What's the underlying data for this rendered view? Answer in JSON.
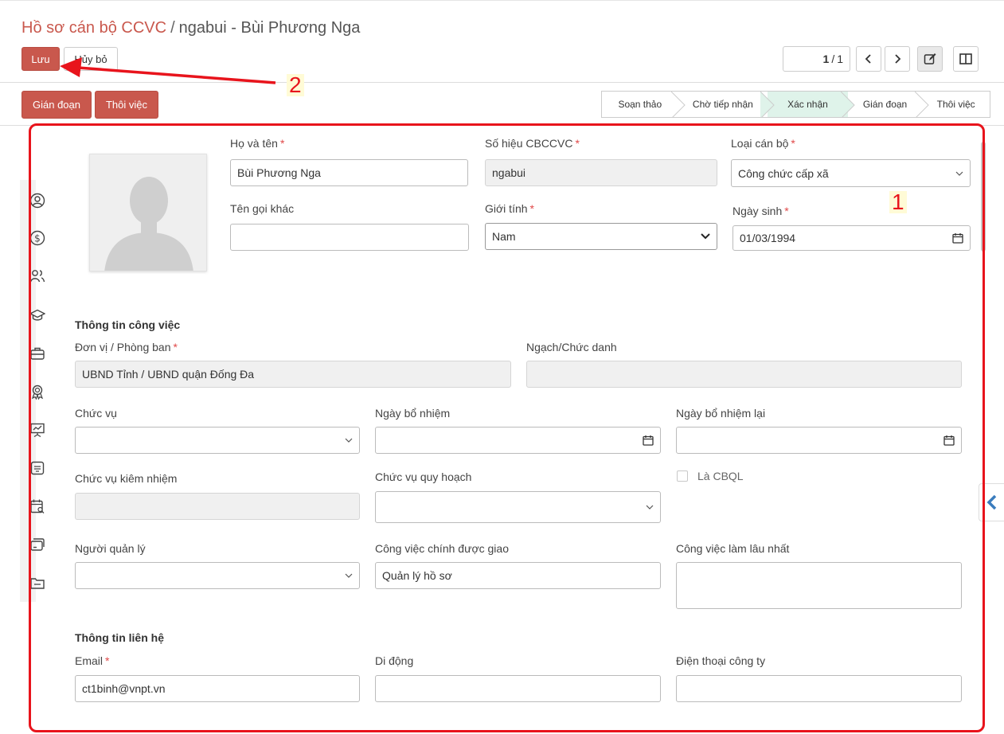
{
  "breadcrumb": {
    "parent": "Hồ sơ cán bộ CCVC",
    "separator": "/",
    "current": "ngabui - Bùi Phương Nga"
  },
  "toolbar": {
    "save_label": "Lưu",
    "discard_label": "Hủy bỏ"
  },
  "pager": {
    "current": "1",
    "total": "1"
  },
  "actions": {
    "interrupt_label": "Gián đoạn",
    "resign_label": "Thôi việc"
  },
  "statusbar": {
    "stages": [
      {
        "label": "Soạn thảo",
        "active": false
      },
      {
        "label": "Chờ tiếp nhận",
        "active": false
      },
      {
        "label": "Xác nhận",
        "active": true
      },
      {
        "label": "Gián đoạn",
        "active": false
      },
      {
        "label": "Thôi việc",
        "active": false
      }
    ]
  },
  "annotations": {
    "box_number": "1",
    "arrow_number": "2"
  },
  "colors": {
    "accent": "#c9584d",
    "annotation": "#e8141c",
    "active_stage": "#dff3ea"
  },
  "personal": {
    "full_name_label": "Họ và tên",
    "full_name": "Bùi Phương Nga",
    "code_label": "Số hiệu CBCCVC",
    "code": "ngabui",
    "staff_type_label": "Loại cán bộ",
    "staff_type": "Công chức cấp xã",
    "alias_label": "Tên gọi khác",
    "alias": "",
    "gender_label": "Giới tính",
    "gender": "Nam",
    "dob_label": "Ngày sinh",
    "dob": "01/03/1994"
  },
  "work": {
    "section_title": "Thông tin công việc",
    "department_label": "Đơn vị / Phòng ban",
    "department": "UBND Tỉnh / UBND quận Đống Đa",
    "rank_label": "Ngạch/Chức danh",
    "rank": "",
    "position_label": "Chức vụ",
    "position": "",
    "appointed_label": "Ngày bổ nhiệm",
    "appointed": "",
    "reappointed_label": "Ngày bổ nhiệm lại",
    "reappointed": "",
    "concurrent_label": "Chức vụ kiêm nhiệm",
    "concurrent": "",
    "planned_label": "Chức vụ quy hoạch",
    "planned": "",
    "is_manager_label": "Là CBQL",
    "is_manager": false,
    "manager_label": "Người quản lý",
    "manager": "",
    "main_job_label": "Công việc chính được giao",
    "main_job": "Quản lý hồ sơ",
    "longest_job_label": "Công việc làm lâu nhất",
    "longest_job": ""
  },
  "contact": {
    "section_title": "Thông tin liên hệ",
    "email_label": "Email",
    "email": "ct1binh@vnpt.vn",
    "mobile_label": "Di động",
    "mobile": "",
    "office_phone_label": "Điện thoại công ty",
    "office_phone": ""
  },
  "sidebar_icons": [
    "user-circle-icon",
    "dollar-circle-icon",
    "users-icon",
    "graduation-cap-icon",
    "briefcase-icon",
    "award-icon",
    "presentation-icon",
    "id-card-icon",
    "calendar-search-icon",
    "cards-icon",
    "folder-icon"
  ]
}
